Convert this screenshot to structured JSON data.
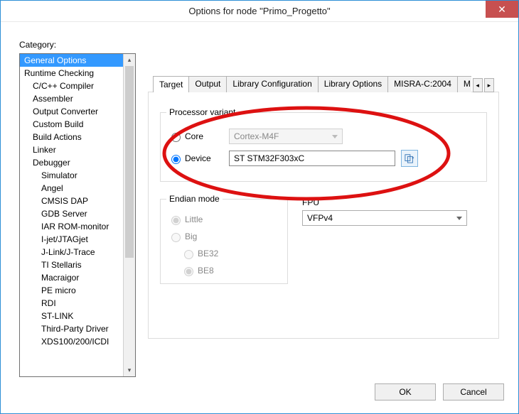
{
  "window": {
    "title": "Options for node \"Primo_Progetto\""
  },
  "category": {
    "label": "Category:",
    "items": [
      {
        "t": "General Options",
        "i": 0,
        "sel": true
      },
      {
        "t": "Runtime Checking",
        "i": 0
      },
      {
        "t": "C/C++ Compiler",
        "i": 1
      },
      {
        "t": "Assembler",
        "i": 1
      },
      {
        "t": "Output Converter",
        "i": 1
      },
      {
        "t": "Custom Build",
        "i": 1
      },
      {
        "t": "Build Actions",
        "i": 1
      },
      {
        "t": "Linker",
        "i": 1
      },
      {
        "t": "Debugger",
        "i": 1
      },
      {
        "t": "Simulator",
        "i": 2
      },
      {
        "t": "Angel",
        "i": 2
      },
      {
        "t": "CMSIS DAP",
        "i": 2
      },
      {
        "t": "GDB Server",
        "i": 2
      },
      {
        "t": "IAR ROM-monitor",
        "i": 2
      },
      {
        "t": "I-jet/JTAGjet",
        "i": 2
      },
      {
        "t": "J-Link/J-Trace",
        "i": 2
      },
      {
        "t": "TI Stellaris",
        "i": 2
      },
      {
        "t": "Macraigor",
        "i": 2
      },
      {
        "t": "PE micro",
        "i": 2
      },
      {
        "t": "RDI",
        "i": 2
      },
      {
        "t": "ST-LINK",
        "i": 2
      },
      {
        "t": "Third-Party Driver",
        "i": 2
      },
      {
        "t": "XDS100/200/ICDI",
        "i": 2
      }
    ]
  },
  "tabs": [
    "Target",
    "Output",
    "Library Configuration",
    "Library Options",
    "MISRA-C:2004",
    "MISR"
  ],
  "processor": {
    "group_title": "Processor variant",
    "core_label": "Core",
    "core_value": "Cortex-M4F",
    "device_label": "Device",
    "device_value": "ST STM32F303xC"
  },
  "endian": {
    "group_title": "Endian mode",
    "little": "Little",
    "big": "Big",
    "be32": "BE32",
    "be8": "BE8"
  },
  "fpu": {
    "label": "FPU",
    "value": "VFPv4"
  },
  "buttons": {
    "ok": "OK",
    "cancel": "Cancel"
  }
}
